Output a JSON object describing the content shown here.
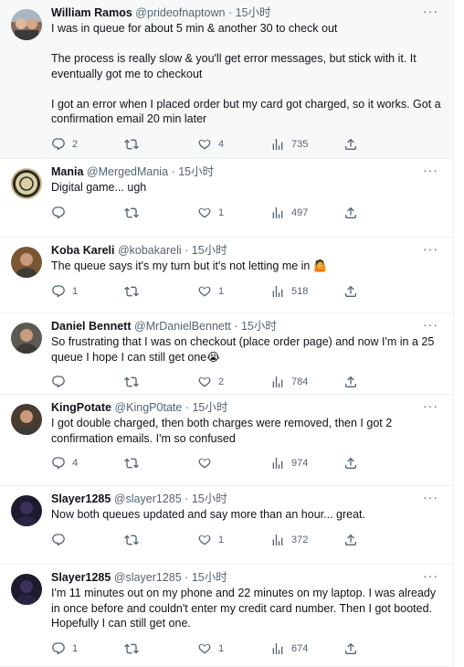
{
  "tweets": [
    {
      "name": "William Ramos",
      "handle": "@prideofnaptown",
      "time": "15小时",
      "paragraphs": [
        "I was in queue for about 5 min & another 30 to check out",
        "The process is really slow & you'll get error messages, but stick with it. It eventually got me to checkout",
        "I got an error when I placed order but my card got charged, so it works. Got a confirmation email 20 min later"
      ],
      "replies": "2",
      "retweets": "",
      "likes": "4",
      "views": "735",
      "avatar": "couple-photo",
      "avatar_color": "#8a6b5a"
    },
    {
      "name": "Mania",
      "handle": "@MergedMania",
      "time": "15小时",
      "paragraphs": [
        "Digital game... ugh"
      ],
      "replies": "",
      "retweets": "",
      "likes": "1",
      "views": "497",
      "avatar": "seal-emblem",
      "avatar_color": "#c9b98a"
    },
    {
      "name": "Koba Kareli",
      "handle": "@kobakareli",
      "time": "15小时",
      "paragraphs": [
        "The queue says it's my turn but it's not letting me in 🤷"
      ],
      "replies": "1",
      "retweets": "",
      "likes": "1",
      "views": "518",
      "avatar": "guitar-photo",
      "avatar_color": "#7a5632"
    },
    {
      "name": "Daniel Bennett",
      "handle": "@MrDanielBennett",
      "time": "15小时",
      "paragraphs": [
        "So frustrating that I was on checkout (place order page) and now I'm in a 25 queue  I hope I can still get one😭"
      ],
      "replies": "",
      "retweets": "",
      "likes": "2",
      "views": "784",
      "avatar": "man-photo",
      "avatar_color": "#5c5a52"
    },
    {
      "name": "KingPotate",
      "handle": "@KingP0tate",
      "time": "15小时",
      "paragraphs": [
        "I got double charged, then both charges were removed, then I got 2 confirmation emails. I'm so confused"
      ],
      "replies": "4",
      "retweets": "",
      "likes": "",
      "views": "974",
      "avatar": "bearded-man-photo",
      "avatar_color": "#4a3b30"
    },
    {
      "name": "Slayer1285",
      "handle": "@slayer1285",
      "time": "15小时",
      "paragraphs": [
        "Now both queues updated and say more than an hour... great."
      ],
      "replies": "",
      "retweets": "",
      "likes": "1",
      "views": "372",
      "avatar": "dark-figure-photo",
      "avatar_color": "#1e1a2e"
    },
    {
      "name": "Slayer1285",
      "handle": "@slayer1285",
      "time": "15小时",
      "paragraphs": [
        "I'm 11 minutes out on my phone and 22 minutes on my laptop. I was already in once before and couldn't enter my credit card number. Then I got booted. Hopefully I can still get one."
      ],
      "replies": "1",
      "retweets": "",
      "likes": "1",
      "views": "674",
      "avatar": "dark-figure-photo",
      "avatar_color": "#1e1a2e"
    }
  ],
  "ui": {
    "separator": "·",
    "more_glyph": "···",
    "icons": [
      "reply-icon",
      "retweet-icon",
      "like-icon",
      "views-icon",
      "share-icon"
    ]
  }
}
